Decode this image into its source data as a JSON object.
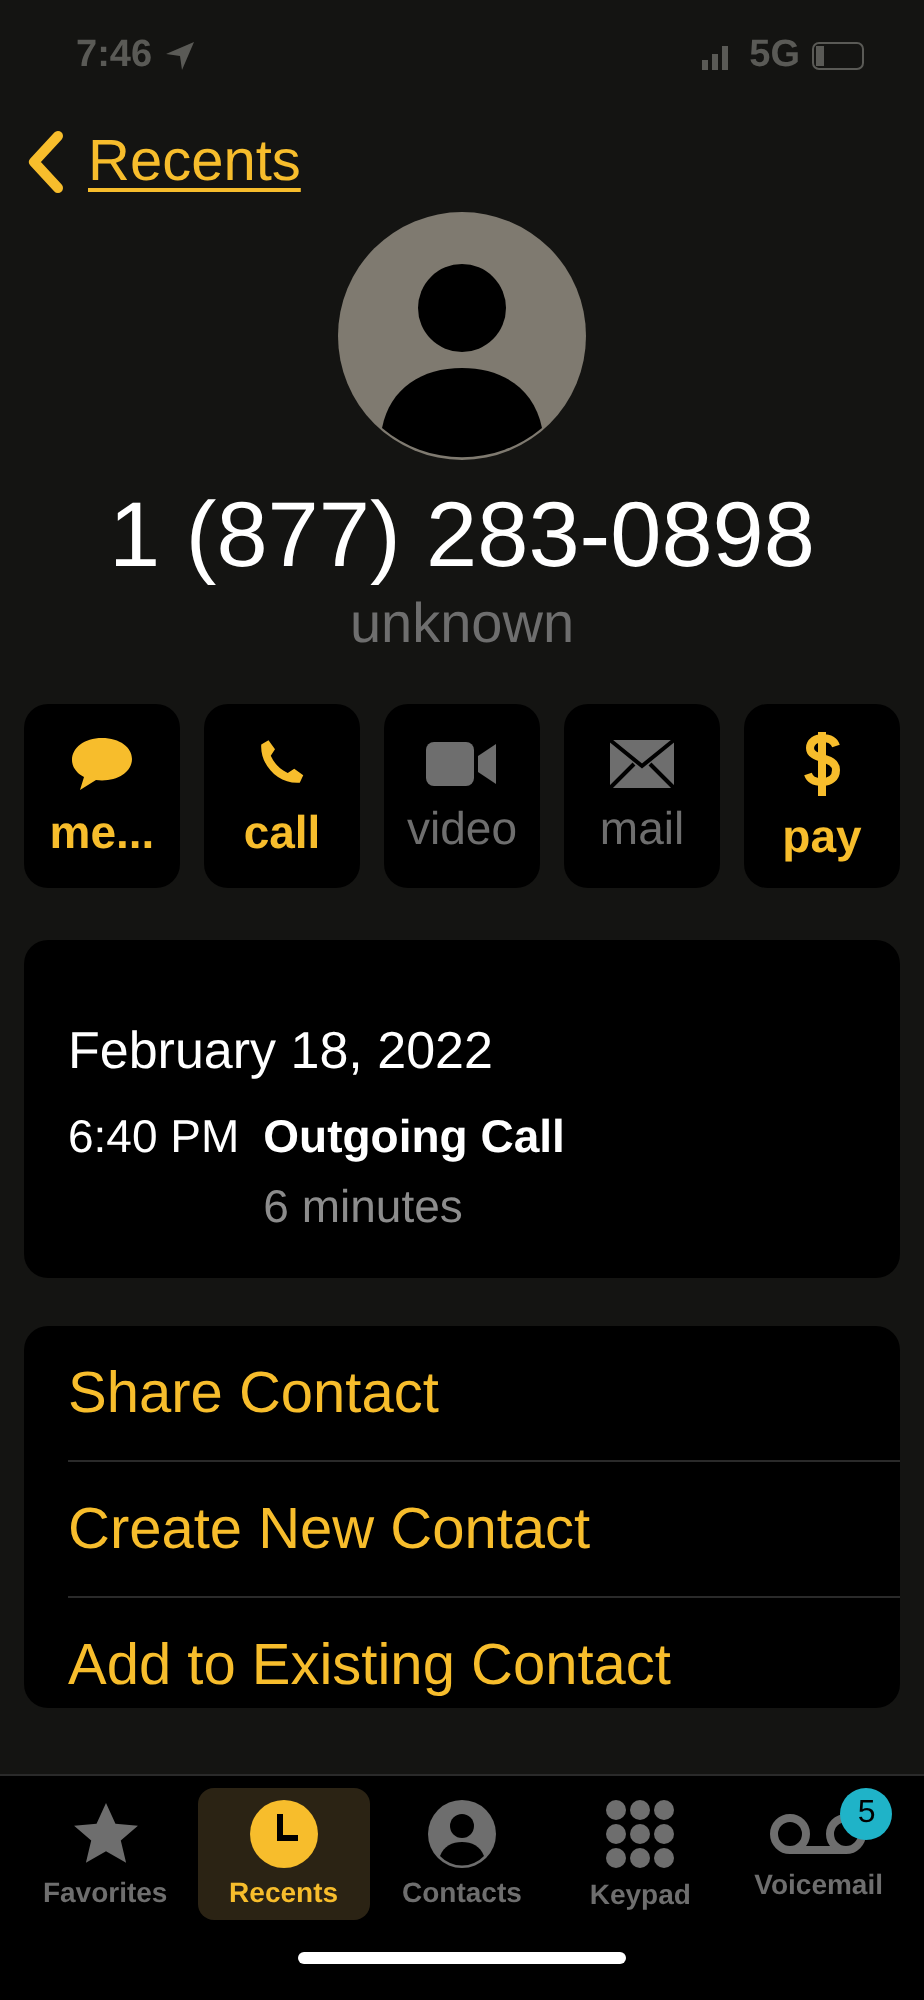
{
  "status_bar": {
    "time": "7:46",
    "network": "5G"
  },
  "nav": {
    "back_label": "Recents"
  },
  "contact": {
    "number": "1 (877) 283-0898",
    "label": "unknown"
  },
  "actions": [
    {
      "kind": "message",
      "label": "me...",
      "disabled": false
    },
    {
      "kind": "call",
      "label": "call",
      "disabled": false
    },
    {
      "kind": "video",
      "label": "video",
      "disabled": true
    },
    {
      "kind": "mail",
      "label": "mail",
      "disabled": true
    },
    {
      "kind": "pay",
      "label": "pay",
      "disabled": false
    }
  ],
  "call_log": {
    "date": "February 18, 2022",
    "entries": [
      {
        "time": "6:40 PM",
        "type": "Outgoing Call",
        "duration": "6 minutes"
      }
    ]
  },
  "menu": [
    "Share Contact",
    "Create New Contact",
    "Add to Existing Contact"
  ],
  "tab_bar": [
    {
      "kind": "favorites",
      "label": "Favorites",
      "selected": false
    },
    {
      "kind": "recents",
      "label": "Recents",
      "selected": true
    },
    {
      "kind": "contacts",
      "label": "Contacts",
      "selected": false
    },
    {
      "kind": "keypad",
      "label": "Keypad",
      "selected": false
    },
    {
      "kind": "voicemail",
      "label": "Voicemail",
      "selected": false,
      "badge": "5"
    }
  ]
}
